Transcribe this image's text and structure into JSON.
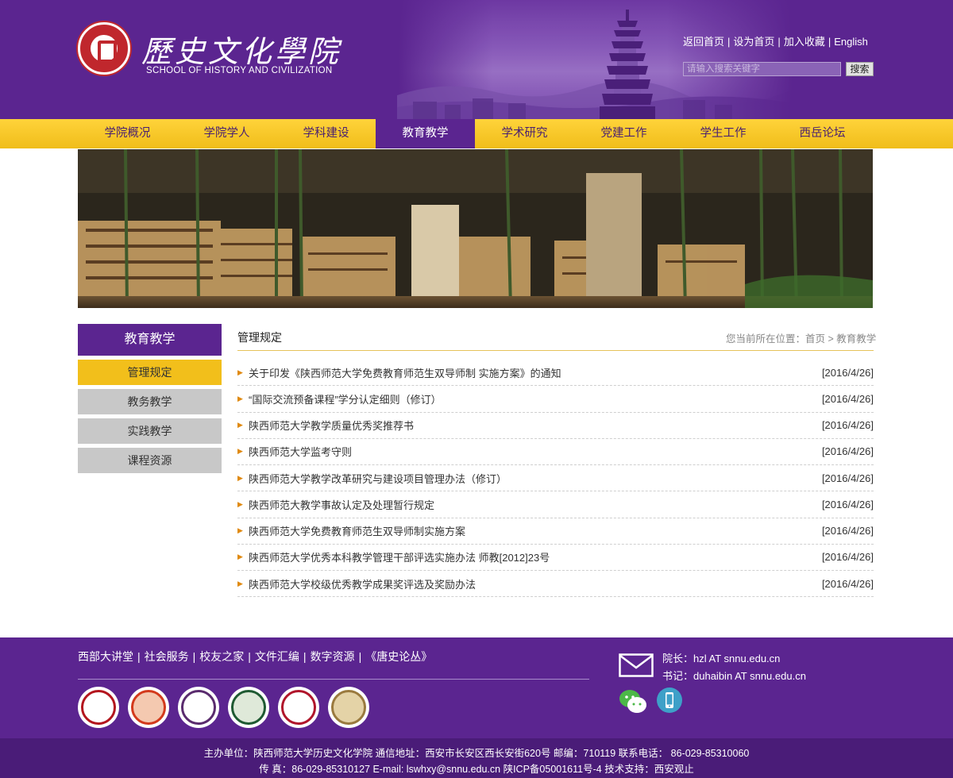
{
  "header": {
    "logo_title": "歷史文化學院",
    "logo_subtitle": "SCHOOL OF HISTORY AND CIVILIZATION",
    "top_links": [
      "返回首页",
      "设为首页",
      "加入收藏",
      "English"
    ],
    "search": {
      "placeholder": "请输入搜索关键字",
      "button_label": "搜索"
    }
  },
  "nav": {
    "items": [
      "学院概况",
      "学院学人",
      "学科建设",
      "教育教学",
      "学术研究",
      "党建工作",
      "学生工作",
      "西岳论坛"
    ],
    "active": "教育教学"
  },
  "sidebar": {
    "title": "教育教学",
    "items": [
      "管理规定",
      "教务教学",
      "实践教学",
      "课程资源"
    ],
    "active": "管理规定"
  },
  "content": {
    "title": "管理规定",
    "breadcrumb": {
      "prefix": "您当前所在位置：",
      "home": "首页",
      "separator": " > ",
      "current": "教育教学"
    },
    "items": [
      {
        "title": "关于印发《陕西师范大学免费教育师范生双导师制 实施方案》的通知",
        "date": "[2016/4/26]"
      },
      {
        "title": "“国际交流预备课程”学分认定细则（修订）",
        "date": "[2016/4/26]"
      },
      {
        "title": "陕西师范大学教学质量优秀奖推荐书",
        "date": "[2016/4/26]"
      },
      {
        "title": "陕西师范大学监考守则",
        "date": "[2016/4/26]"
      },
      {
        "title": "陕西师范大学教学改革研究与建设项目管理办法（修订）",
        "date": "[2016/4/26]"
      },
      {
        "title": "陕西师范大教学事故认定及处理暂行规定",
        "date": "[2016/4/26]"
      },
      {
        "title": "陕西师范大学免费教育师范生双导师制实施方案",
        "date": "[2016/4/26]"
      },
      {
        "title": "陕西师范大学优秀本科教学管理干部评选实施办法 师教[2012]23号",
        "date": "[2016/4/26]"
      },
      {
        "title": "陕西师范大学校级优秀教学成果奖评选及奖励办法",
        "date": "[2016/4/26]"
      }
    ]
  },
  "footer": {
    "links": [
      "西部大讲堂",
      "社会服务",
      "校友之家",
      "文件汇编",
      "数字资源",
      "《唐史论丛》"
    ],
    "contacts": [
      {
        "label": "院长：",
        "value": "hzl AT snnu.edu.cn"
      },
      {
        "label": "书记：",
        "value": "duhaibin AT snnu.edu.cn"
      }
    ],
    "partner_logos": [
      "peking-university-logo",
      "fudan-university-logo",
      "nankai-university-logo",
      "wuhan-university-logo",
      "renmin-university-logo",
      "northwest-university-logo"
    ],
    "bottom_lines": [
      "主办单位：陕西师范大学历史文化学院 通信地址：西安市长安区西长安街620号 邮编：710119 联系电话： 86-029-85310060",
      "传 真：86-029-85310127 E-mail: lswhxy@snnu.edu.cn 陕ICP备05001611号-4 技术支持：西安观止"
    ]
  },
  "colors": {
    "primary_purple": "#5b2590",
    "accent_yellow": "#f2bf1b",
    "bullet_orange": "#e08a12"
  }
}
